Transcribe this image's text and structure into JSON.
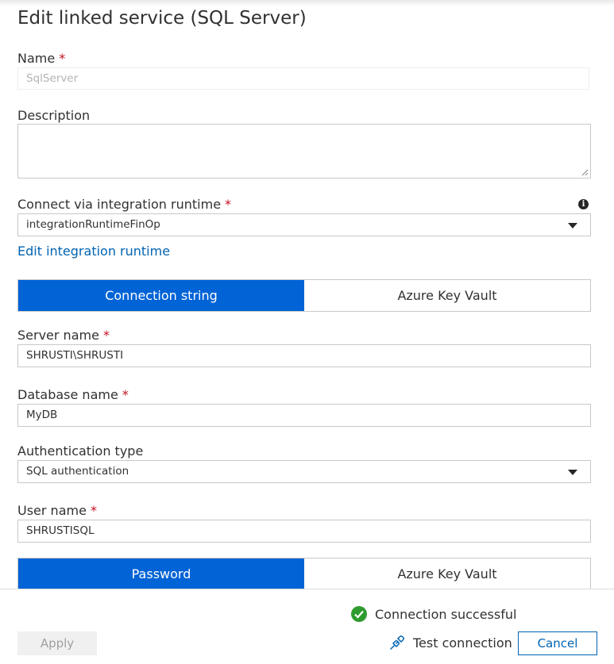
{
  "panel": {
    "title": "Edit linked service (SQL Server)"
  },
  "name": {
    "label": "Name",
    "required": "*",
    "value": "SqlServer"
  },
  "description": {
    "label": "Description",
    "value": ""
  },
  "integration_runtime": {
    "label": "Connect via integration runtime",
    "required": "*",
    "value": "integrationRuntimeFinOp",
    "info_icon": "info-icon",
    "edit_link": "Edit integration runtime"
  },
  "connection_toggle": {
    "selected": "Connection string",
    "options": [
      "Connection string",
      "Azure Key Vault"
    ]
  },
  "server_name": {
    "label": "Server name",
    "required": "*",
    "value": "SHRUSTI\\SHRUSTI"
  },
  "database_name": {
    "label": "Database name",
    "required": "*",
    "value": "MyDB"
  },
  "auth_type": {
    "label": "Authentication type",
    "value": "SQL authentication"
  },
  "user_name": {
    "label": "User name",
    "required": "*",
    "value": "SHRUSTISQL"
  },
  "password_toggle": {
    "selected": "Password",
    "options": [
      "Password",
      "Azure Key Vault"
    ]
  },
  "footer": {
    "status": "Connection successful",
    "apply": "Apply",
    "test_connection": "Test connection",
    "cancel": "Cancel"
  },
  "colors": {
    "accent": "#0063d6",
    "link": "#0063b1",
    "success": "#2e9b2e",
    "required": "#c50f1f"
  }
}
